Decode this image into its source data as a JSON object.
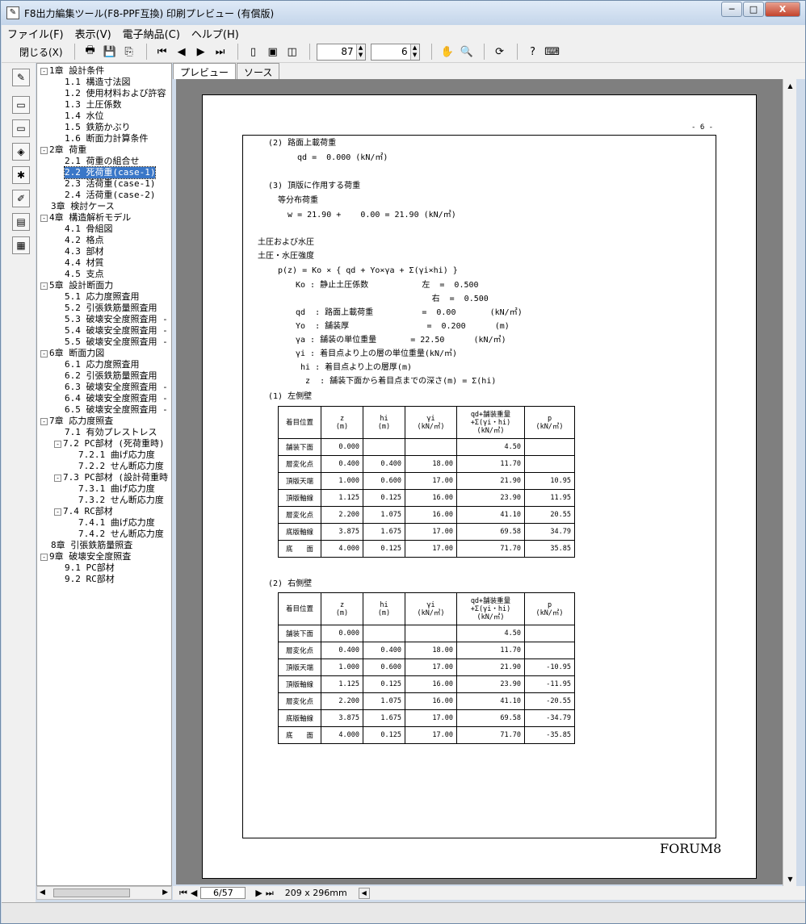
{
  "window": {
    "title": "F8出力編集ツール(F8-PPF互換) 印刷プレビュー (有償版)",
    "min": "─",
    "max": "□",
    "close": "X"
  },
  "menu": [
    "ファイル(F)",
    "表示(V)",
    "電子納品(C)",
    "ヘルプ(H)"
  ],
  "toolbar": {
    "close_label": "閉じる(X)",
    "zoom": "87",
    "page_count_spin": "6"
  },
  "tabs": [
    "プレビュー",
    "ソース"
  ],
  "tree": [
    {
      "label": "1章 設計条件",
      "level": 0,
      "box": "-"
    },
    {
      "label": "1.1 構造寸法図",
      "level": 1
    },
    {
      "label": "1.2 使用材料および許容",
      "level": 1
    },
    {
      "label": "1.3 土圧係数",
      "level": 1
    },
    {
      "label": "1.4 水位",
      "level": 1
    },
    {
      "label": "1.5 鉄筋かぶり",
      "level": 1
    },
    {
      "label": "1.6 断面力計算条件",
      "level": 1
    },
    {
      "label": "2章 荷重",
      "level": 0,
      "box": "-"
    },
    {
      "label": "2.1 荷重の組合せ",
      "level": 1
    },
    {
      "label": "2.2 死荷重(case-1)",
      "level": 1,
      "selected": true
    },
    {
      "label": "2.3 活荷重(case-1)",
      "level": 1
    },
    {
      "label": "2.4 活荷重(case-2)",
      "level": 1
    },
    {
      "label": "3章 検討ケース",
      "level": 0
    },
    {
      "label": "4章 構造解析モデル",
      "level": 0,
      "box": "-"
    },
    {
      "label": "4.1 骨組図",
      "level": 1
    },
    {
      "label": "4.2 格点",
      "level": 1
    },
    {
      "label": "4.3 部材",
      "level": 1
    },
    {
      "label": "4.4 材質",
      "level": 1
    },
    {
      "label": "4.5 支点",
      "level": 1
    },
    {
      "label": "5章 設計断面力",
      "level": 0,
      "box": "-"
    },
    {
      "label": "5.1 応力度照査用",
      "level": 1
    },
    {
      "label": "5.2 引張鉄筋量照査用",
      "level": 1
    },
    {
      "label": "5.3 破壊安全度照査用 -",
      "level": 1
    },
    {
      "label": "5.4 破壊安全度照査用 -",
      "level": 1
    },
    {
      "label": "5.5 破壊安全度照査用 -",
      "level": 1
    },
    {
      "label": "6章 断面力図",
      "level": 0,
      "box": "-"
    },
    {
      "label": "6.1 応力度照査用",
      "level": 1
    },
    {
      "label": "6.2 引張鉄筋量照査用",
      "level": 1
    },
    {
      "label": "6.3 破壊安全度照査用 -",
      "level": 1
    },
    {
      "label": "6.4 破壊安全度照査用 -",
      "level": 1
    },
    {
      "label": "6.5 破壊安全度照査用 -",
      "level": 1
    },
    {
      "label": "7章 応力度照査",
      "level": 0,
      "box": "-"
    },
    {
      "label": "7.1 有効プレストレス",
      "level": 1
    },
    {
      "label": "7.2 PC部材 (死荷重時)",
      "level": 1,
      "box": "-"
    },
    {
      "label": "7.2.1 曲げ応力度",
      "level": 2
    },
    {
      "label": "7.2.2 せん断応力度",
      "level": 2
    },
    {
      "label": "7.3 PC部材 (設計荷重時",
      "level": 1,
      "box": "-"
    },
    {
      "label": "7.3.1 曲げ応力度",
      "level": 2
    },
    {
      "label": "7.3.2 せん断応力度",
      "level": 2
    },
    {
      "label": "7.4 RC部材",
      "level": 1,
      "box": "-"
    },
    {
      "label": "7.4.1 曲げ応力度",
      "level": 2
    },
    {
      "label": "7.4.2 せん断応力度",
      "level": 2
    },
    {
      "label": "8章 引張鉄筋量照査",
      "level": 0
    },
    {
      "label": "9章 破壊安全度照査",
      "level": 0,
      "box": "-"
    },
    {
      "label": "9.1 PC部材",
      "level": 1
    },
    {
      "label": "9.2 RC部材",
      "level": 1
    }
  ],
  "page": {
    "page_number": "- 6 -",
    "footer": "FORUM8",
    "lines": [
      "(2) 路面上載荷重",
      "  qd =  0.000 (kN/㎡)",
      "(3) 頂版に作用する荷重",
      "等分布荷重",
      "  w = 21.90 +    0.00 = 21.90 (kN/㎡)",
      "土圧および水圧",
      "土圧・水圧強度",
      "p(z) = Ko × { qd + Yo×γa + Σ(γi×hi) }",
      "Ko : 静止土圧係数           左  =  0.500",
      "                            右  =  0.500",
      "qd  : 路面上載荷重          =  0.00       (kN/㎡)",
      "Yo  : 舗装厚                =  0.200      (m)",
      "γa : 舗装の単位重量       = 22.50      (kN/㎥)",
      "γi : 着目点より上の層の単位重量(kN/㎥)",
      " hi : 着目点より上の層厚(m)",
      "  z  : 舗装下面から着目点までの深さ(m) = Σ(hi)",
      "(1) 左側壁",
      "(2) 右側壁"
    ],
    "table_headers": [
      "着目位置",
      "z\n(m)",
      "hi\n(m)",
      "γi\n(kN/㎥)",
      "qd+舗装重量\n+Σ(γi・hi)\n(kN/㎡)",
      "p\n(kN/㎡)"
    ],
    "left_table": [
      [
        "舗装下面",
        "0.000",
        "",
        "",
        "4.50",
        ""
      ],
      [
        "層変化点",
        "0.400",
        "0.400",
        "18.00",
        "11.70",
        ""
      ],
      [
        "頂版天端",
        "1.000",
        "0.600",
        "17.00",
        "21.90",
        "10.95"
      ],
      [
        "頂版軸線",
        "1.125",
        "0.125",
        "16.00",
        "23.90",
        "11.95"
      ],
      [
        "層変化点",
        "2.200",
        "1.075",
        "16.00",
        "41.10",
        "20.55"
      ],
      [
        "底版軸線",
        "3.875",
        "1.675",
        "17.00",
        "69.58",
        "34.79"
      ],
      [
        "底　　面",
        "4.000",
        "0.125",
        "17.00",
        "71.70",
        "35.85"
      ]
    ],
    "right_table": [
      [
        "舗装下面",
        "0.000",
        "",
        "",
        "4.50",
        ""
      ],
      [
        "層変化点",
        "0.400",
        "0.400",
        "18.00",
        "11.70",
        ""
      ],
      [
        "頂版天端",
        "1.000",
        "0.600",
        "17.00",
        "21.90",
        "-10.95"
      ],
      [
        "頂版軸線",
        "1.125",
        "0.125",
        "16.00",
        "23.90",
        "-11.95"
      ],
      [
        "層変化点",
        "2.200",
        "1.075",
        "16.00",
        "41.10",
        "-20.55"
      ],
      [
        "底版軸線",
        "3.875",
        "1.675",
        "17.00",
        "69.58",
        "-34.79"
      ],
      [
        "底　　面",
        "4.000",
        "0.125",
        "17.00",
        "71.70",
        "-35.85"
      ]
    ]
  },
  "status": {
    "page_indicator": "6/57",
    "paper_size": "209 x 296mm"
  }
}
